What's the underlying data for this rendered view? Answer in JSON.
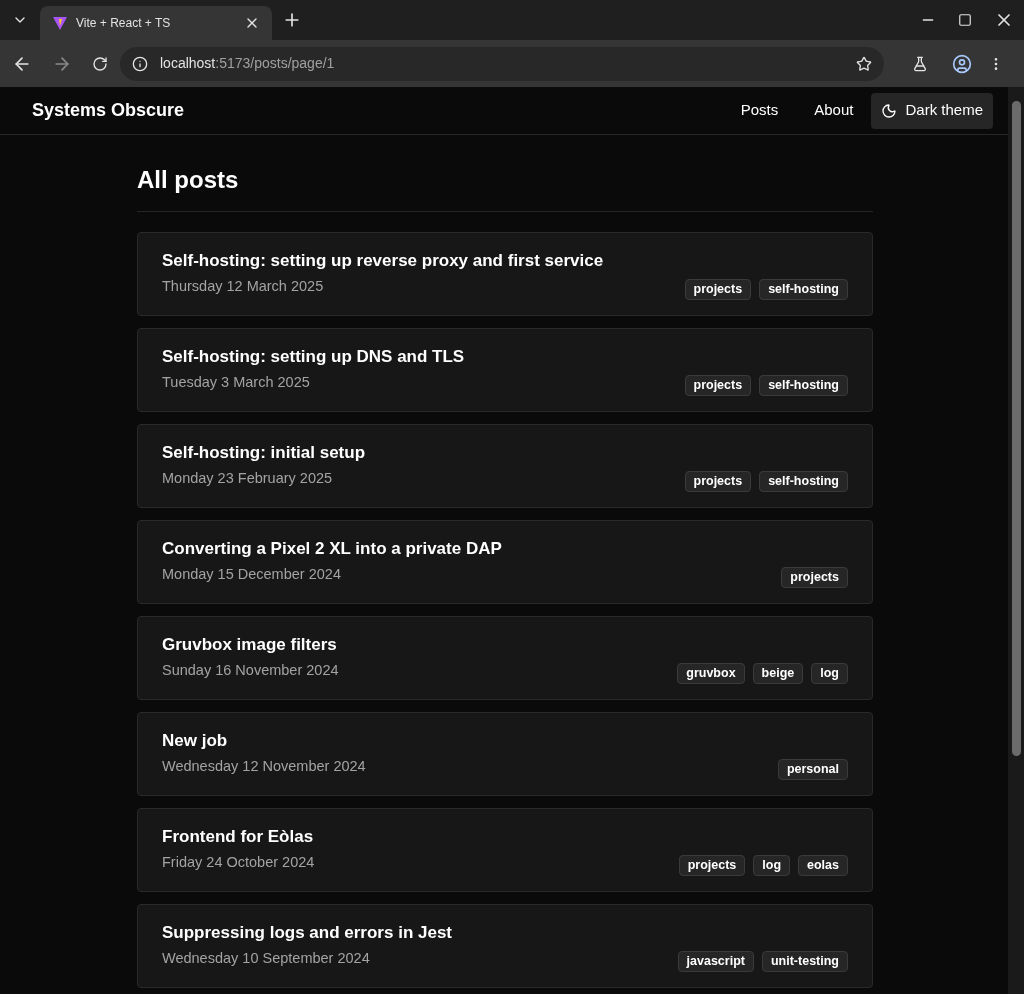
{
  "browser": {
    "tab_title": "Vite + React + TS",
    "url_host": "localhost",
    "url_path": ":5173/posts/page/1"
  },
  "site": {
    "title": "Systems Obscure",
    "nav": [
      {
        "label": "Posts"
      },
      {
        "label": "About"
      }
    ],
    "theme_button": "Dark theme"
  },
  "heading": "All posts",
  "posts": [
    {
      "title": "Self-hosting: setting up reverse proxy and first service",
      "date": "Thursday 12 March 2025",
      "tags": [
        "projects",
        "self-hosting"
      ]
    },
    {
      "title": "Self-hosting: setting up DNS and TLS",
      "date": "Tuesday 3 March 2025",
      "tags": [
        "projects",
        "self-hosting"
      ]
    },
    {
      "title": "Self-hosting: initial setup",
      "date": "Monday 23 February 2025",
      "tags": [
        "projects",
        "self-hosting"
      ]
    },
    {
      "title": "Converting a Pixel 2 XL into a private DAP",
      "date": "Monday 15 December 2024",
      "tags": [
        "projects"
      ]
    },
    {
      "title": "Gruvbox image filters",
      "date": "Sunday 16 November 2024",
      "tags": [
        "gruvbox",
        "beige",
        "log"
      ]
    },
    {
      "title": "New job",
      "date": "Wednesday 12 November 2024",
      "tags": [
        "personal"
      ]
    },
    {
      "title": "Frontend for Eòlas",
      "date": "Friday 24 October 2024",
      "tags": [
        "projects",
        "log",
        "eolas"
      ]
    },
    {
      "title": "Suppressing logs and errors in Jest",
      "date": "Wednesday 10 September 2024",
      "tags": [
        "javascript",
        "unit-testing"
      ]
    }
  ]
}
